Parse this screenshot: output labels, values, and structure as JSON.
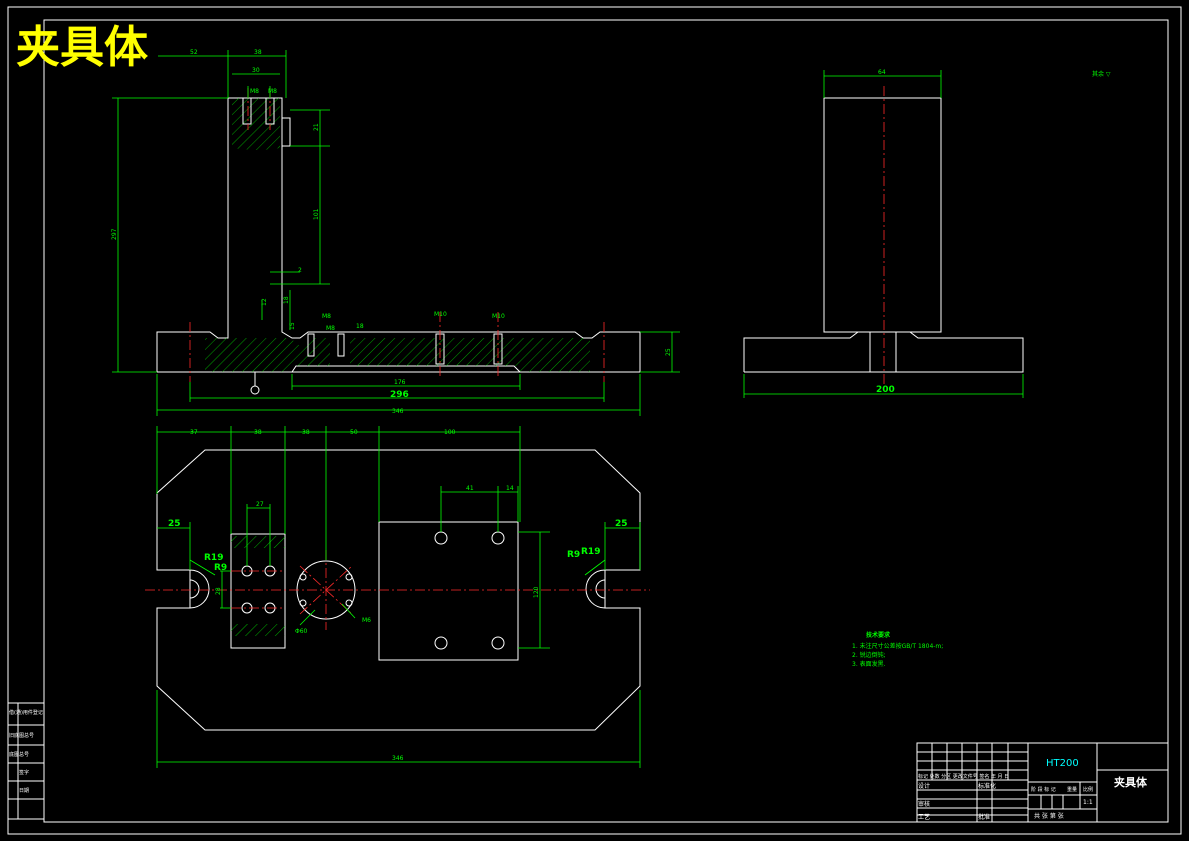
{
  "title": "夹具体",
  "views": {
    "front_dims": {
      "top_52": "52",
      "top_38": "38",
      "top_30": "30",
      "m8a": "M8",
      "m8b": "M8",
      "d21": "21",
      "d101": "101",
      "d2": "2",
      "d18": "18",
      "d12": "12",
      "d15": "15",
      "d297": "297",
      "d25": "25",
      "m8c": "M8",
      "m8d": "M8",
      "m10a": "M10",
      "m10b": "M10",
      "d18b": "18",
      "d176": "176",
      "d296": "296",
      "d346": "346"
    },
    "side_dims": {
      "width": "64",
      "base": "200"
    },
    "roughness_note": "其余 ▽"
  },
  "plan_dims": {
    "top": [
      "37",
      "38",
      "38",
      "50",
      "100"
    ],
    "inner_41": "41",
    "inner_14": "14",
    "inner_27": "27",
    "left_25": "25",
    "right_25": "25",
    "r19_left": "R19",
    "r9_left": "R9",
    "r9_right": "R9",
    "r19_right": "R19",
    "d120": "120",
    "d28": "28",
    "phi60": "Φ60",
    "m6": "M6",
    "d346": "346"
  },
  "tech_requirements": {
    "heading": "技术要求",
    "items": [
      "1. 未注尺寸公差按GB/T 1804-m;",
      "2. 锐边倒钝;",
      "3. 表面发黑."
    ]
  },
  "title_block": {
    "material": "HT200",
    "part_name": "夹具体",
    "header_row": "标记 处数 分区 更改文件号 签名 年 月 日",
    "labels": {
      "design": "设计",
      "standardize": "标准化",
      "review": "审核",
      "process": "工艺",
      "approve": "批准",
      "stage": "阶 段 标 记",
      "weight": "重量",
      "ratio": "比例",
      "ratio_value": "1:1",
      "sheets": "共  张  第  张"
    }
  },
  "side_panel": {
    "items": [
      "借(通)用件登记",
      "旧底图总号",
      "底图总号",
      "签字",
      "日期"
    ]
  }
}
